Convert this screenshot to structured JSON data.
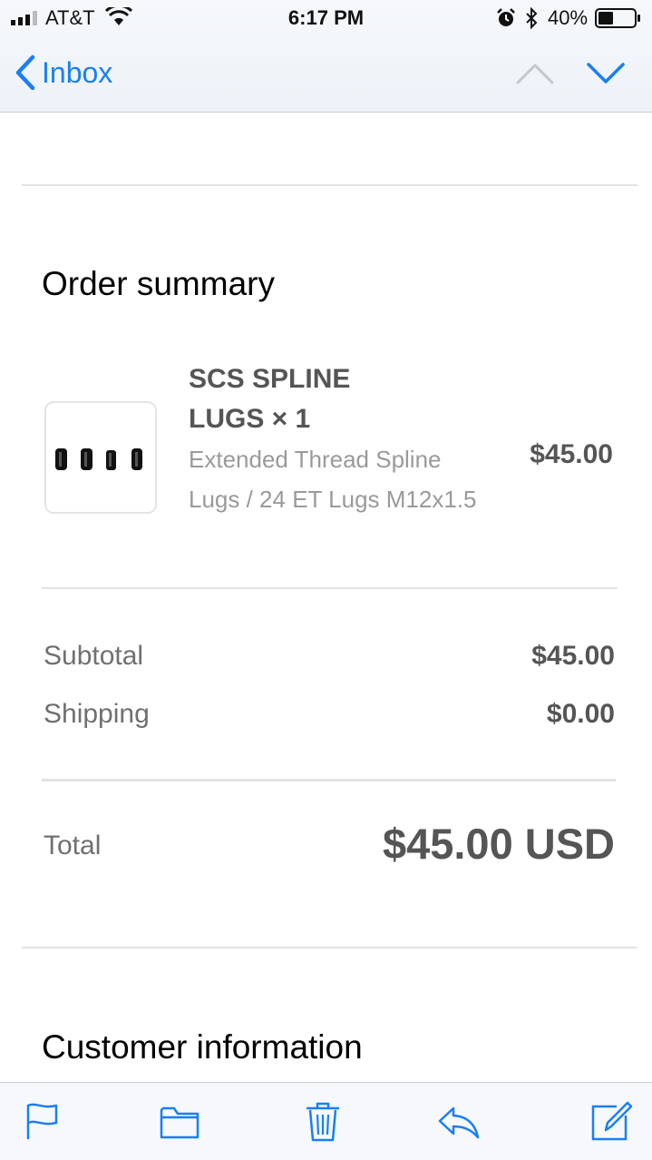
{
  "status_bar": {
    "carrier": "AT&T",
    "time": "6:17 PM",
    "battery": "40%",
    "icons": [
      "signal-icon",
      "wifi-icon",
      "alarm-icon",
      "bluetooth-icon",
      "battery-icon"
    ]
  },
  "nav": {
    "back_label": "Inbox",
    "icons": [
      "chevron-left-icon",
      "chevron-up-icon",
      "chevron-down-icon"
    ]
  },
  "order_summary": {
    "title": "Order summary",
    "item": {
      "name": "SCS SPLINE LUGS × 1",
      "variant": "Extended Thread Spline Lugs / 24 ET Lugs M12x1.5",
      "price": "$45.00"
    },
    "subtotal_label": "Subtotal",
    "subtotal_value": "$45.00",
    "shipping_label": "Shipping",
    "shipping_value": "$0.00",
    "total_label": "Total",
    "total_value": "$45.00 USD"
  },
  "customer_information": {
    "title": "Customer information"
  },
  "toolbar": {
    "icons": [
      "flag-icon",
      "folder-icon",
      "trash-icon",
      "reply-icon",
      "compose-icon"
    ]
  },
  "colors": {
    "accent": "#1a7ef5",
    "text_dark": "#555555",
    "text_muted": "#9a9a9a"
  }
}
